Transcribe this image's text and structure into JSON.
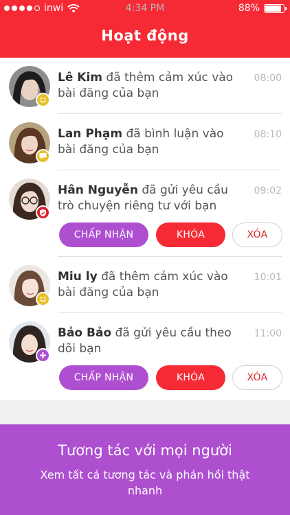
{
  "status": {
    "carrier": "inwi",
    "time": "4:34 PM",
    "battery": "88%",
    "battery_level": 0.88,
    "signal_bars": 4
  },
  "header": {
    "title": "Hoạt động"
  },
  "colors": {
    "red": "#f62a35",
    "purple": "#ae4fd2",
    "yellow": "#e6c02a"
  },
  "notifications": [
    {
      "name": "Lê Kim",
      "message": "đã thêm cảm xúc vào bài đăng của bạn",
      "time": "08:00",
      "badge_icon": "smile-icon"
    },
    {
      "name": "Lan Phạm",
      "message": "đã bình luận vào bài đăng của bạn",
      "time": "08:10",
      "badge_icon": "comment-icon"
    },
    {
      "name": "Hân Nguyễn",
      "message": "đã gửi yêu cầu trò chuyện riêng tư với bạn",
      "time": "09:02",
      "badge_icon": "shield-icon",
      "actions": {
        "accept": "CHẤP NHẬN",
        "block": "KHÓA",
        "delete": "XÓA"
      }
    },
    {
      "name": "Miu ly",
      "message": "đã thêm cảm xúc vào bài đăng của bạn",
      "time": "10:01",
      "badge_icon": "smile-icon"
    },
    {
      "name": "Bảo Bảo",
      "message": "đã gửi yêu cầu theo dõi bạn",
      "time": "11:00",
      "badge_icon": "plus-icon",
      "actions": {
        "accept": "CHẤP NHẬN",
        "block": "KHÓA",
        "delete": "XÓA"
      }
    }
  ],
  "promo": {
    "title": "Tương tác với mọi người",
    "subtitle": "Xem tất cả tương tác và phản hồi thật nhanh"
  }
}
